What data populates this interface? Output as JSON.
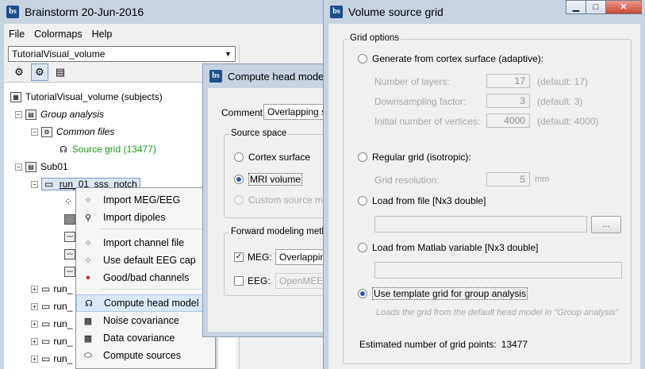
{
  "main": {
    "title": "Brainstorm 20-Jun-2016",
    "menu": [
      "File",
      "Colormaps",
      "Help"
    ],
    "protocol": "TutorialVisual_volume",
    "toolbar_icons": [
      "anatomy-view-icon",
      "functional-view-icon",
      "subject-list-icon"
    ],
    "tree": {
      "root": "TutorialVisual_volume (subjects)",
      "group_analysis": "Group analysis",
      "common_files": "Common files",
      "source_grid": "Source grid (13477)",
      "sub01": "Sub01",
      "selected_run": "run_01_sss_notch",
      "truncated_runs": [
        "run_",
        "run_",
        "run_",
        "run_",
        "run_"
      ]
    }
  },
  "context_menu": {
    "items": [
      {
        "label": "Import MEG/EEG",
        "icon": "import-icon"
      },
      {
        "label": "Import dipoles",
        "icon": "dipoles-icon"
      },
      {
        "label": "Import channel file",
        "icon": "channel-file-icon"
      },
      {
        "label": "Use default EEG cap",
        "icon": "eeg-cap-icon"
      },
      {
        "label": "Good/bad channels",
        "icon": "good-bad-channels-icon"
      },
      {
        "label": "Compute head model",
        "icon": "head-model-icon"
      },
      {
        "label": "Noise covariance",
        "icon": "noise-covariance-icon"
      },
      {
        "label": "Data covariance",
        "icon": "data-covariance-icon"
      },
      {
        "label": "Compute sources",
        "icon": "compute-sources-icon"
      }
    ],
    "highlighted": "Compute head model"
  },
  "head_model_dialog": {
    "title": "Compute head model",
    "comment_label": "Comment:",
    "comment_value": "Overlapping sp",
    "source_space_legend": "Source space",
    "options": [
      "Cortex surface",
      "MRI volume",
      "Custom source mod"
    ],
    "selected_option": "MRI volume",
    "forward_legend": "Forward modeling metho",
    "meg_label": "MEG:",
    "meg_value": "Overlapping",
    "meg_checked": true,
    "eeg_label": "EEG:",
    "eeg_value": "OpenMEEG",
    "eeg_checked": false
  },
  "grid_dialog": {
    "title": "Volume source grid",
    "legend": "Grid options",
    "cortex_option": "Generate from cortex surface (adaptive):",
    "layers_label": "Number of layers:",
    "layers_value": "17",
    "layers_default": "(default: 17)",
    "downsampling_label": "Downsampling factor:",
    "downsampling_value": "3",
    "downsampling_default": "(default: 3)",
    "vertices_label": "Initial number of vertices:",
    "vertices_value": "4000",
    "vertices_default": "(default: 4000)",
    "regular_option": "Regular grid (isotropic):",
    "resolution_label": "Grid resolution:",
    "resolution_value": "5",
    "resolution_unit": "mm",
    "load_file_option": "Load from file [Nx3 double]",
    "browse_label": "...",
    "load_matlab_option": "Load from Matlab variable [Nx3 double]",
    "template_option": "Use template grid for group analysis",
    "template_note": "Loads the grid from the default head model in \"Group analysis\"",
    "estimate_label": "Estimated number of grid points:",
    "estimate_value": "13477",
    "selected_option": "Use template grid for group analysis"
  }
}
